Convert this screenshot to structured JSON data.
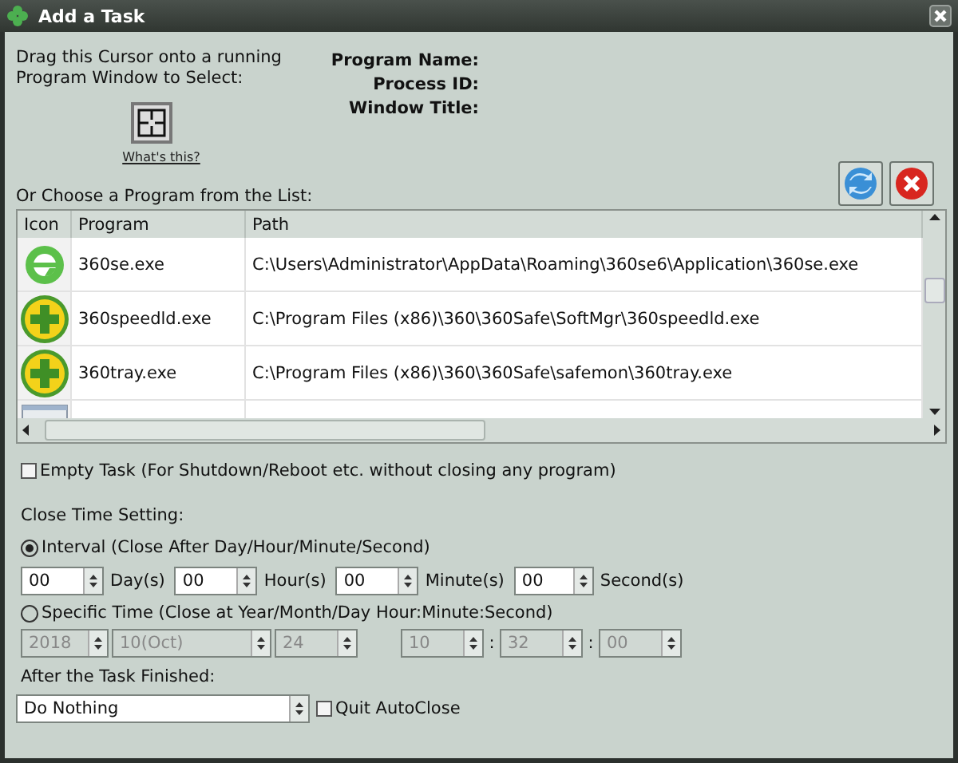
{
  "window": {
    "title": "Add a Task"
  },
  "drag_hint": "Drag this Cursor onto a running Program Window to Select:",
  "whats_this": "What's this?",
  "info_labels": [
    "Program Name:",
    "Process ID:",
    "Window Title:"
  ],
  "list_label": "Or Choose a Program from the List:",
  "table": {
    "columns": [
      "Icon",
      "Program",
      "Path"
    ],
    "rows": [
      {
        "kind": "browser",
        "program": "360se.exe",
        "path": "C:\\Users\\Administrator\\AppData\\Roaming\\360se6\\Application\\360se.exe"
      },
      {
        "kind": "plus",
        "program": "360speedld.exe",
        "path": "C:\\Program Files (x86)\\360\\360Safe\\SoftMgr\\360speedld.exe"
      },
      {
        "kind": "plus",
        "program": "360tray.exe",
        "path": "C:\\Program Files (x86)\\360\\360Safe\\safemon\\360tray.exe"
      },
      {
        "kind": "window"
      }
    ]
  },
  "empty_task": {
    "label": "Empty Task (For Shutdown/Reboot etc. without closing any program)",
    "checked": false
  },
  "close_time_label": "Close Time Setting:",
  "interval": {
    "label": "Interval (Close After Day/Hour/Minute/Second)",
    "selected": true,
    "fields": [
      {
        "value": "00",
        "unit": "Day(s)"
      },
      {
        "value": "00",
        "unit": "Hour(s)"
      },
      {
        "value": "00",
        "unit": "Minute(s)"
      },
      {
        "value": "00",
        "unit": "Second(s)"
      }
    ]
  },
  "specific": {
    "label": "Specific Time (Close at Year/Month/Day Hour:Minute:Second)",
    "selected": false,
    "disabled": true,
    "date": [
      "2018",
      "10(Oct)",
      "24"
    ],
    "time": [
      "10",
      "32",
      "00"
    ],
    "separators": [
      ":",
      ":"
    ]
  },
  "after_label": "After the Task Finished:",
  "action": {
    "value": "Do Nothing"
  },
  "quit_autoclose": {
    "label": "Quit AutoClose",
    "checked": false
  }
}
